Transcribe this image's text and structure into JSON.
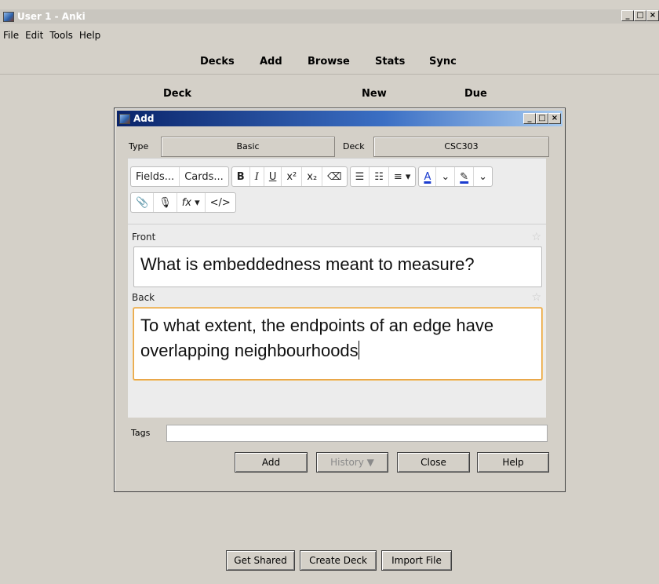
{
  "window": {
    "title": "User 1 - Anki",
    "controls": [
      "_",
      "□",
      "×"
    ]
  },
  "menu": [
    "File",
    "Edit",
    "Tools",
    "Help"
  ],
  "toolbar": {
    "decks": "Decks",
    "add": "Add",
    "browse": "Browse",
    "stats": "Stats",
    "sync": "Sync"
  },
  "deck_list": {
    "col_deck": "Deck",
    "col_new": "New",
    "col_due": "Due"
  },
  "add_dialog": {
    "title": "Add",
    "type_label": "Type",
    "type_value": "Basic",
    "deck_label": "Deck",
    "deck_value": "CSC303",
    "editor_toolbar": {
      "fields": "Fields...",
      "cards": "Cards...",
      "bold": "B",
      "italic": "I",
      "underline": "U",
      "superscript": "x²",
      "subscript": "x₂",
      "eraser": "⌫",
      "bullets": "☰",
      "numbered": "☷",
      "align": "≡ ▾",
      "text_color": "A",
      "color_caret": "⌄",
      "highlight": "✎",
      "highlight_caret": "⌄",
      "attach": "📎",
      "record": "🎙",
      "math": "fx ▾",
      "html": "</>"
    },
    "front_label": "Front",
    "front_value": "What is embeddedness meant to measure?",
    "back_label": "Back",
    "back_line1": "To what extent, the endpoints of an edge have",
    "back_line2": "overlapping neighbourhoods",
    "tags_label": "Tags",
    "tags_value": "",
    "buttons": {
      "add": "Add",
      "history": "History ▼",
      "close": "Close",
      "help": "Help"
    }
  },
  "bottom_buttons": {
    "get_shared": "Get Shared",
    "create_deck": "Create Deck",
    "import_file": "Import File"
  }
}
